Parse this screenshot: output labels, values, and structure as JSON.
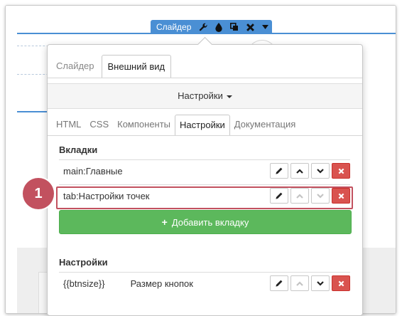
{
  "toolbar": {
    "label": "Слайдер",
    "icons": [
      "wrench-icon",
      "drop-icon",
      "copy-icon",
      "close-icon",
      "caret-down-icon"
    ]
  },
  "tabs_top": [
    {
      "label": "Слайдер",
      "active": false
    },
    {
      "label": "Внешний вид",
      "active": true
    }
  ],
  "settings_dropdown": {
    "label": "Настройки"
  },
  "tabs_inner": [
    {
      "label": "HTML",
      "active": false
    },
    {
      "label": "CSS",
      "active": false
    },
    {
      "label": "Компоненты",
      "active": false
    },
    {
      "label": "Настройки",
      "active": true
    },
    {
      "label": "Документация",
      "active": false
    }
  ],
  "tabs_section": {
    "title": "Вкладки",
    "rows": [
      {
        "name": "main:Главные"
      },
      {
        "name": "tab:Настройки точек"
      }
    ],
    "add_button": "Добавить вкладку"
  },
  "marker": {
    "number": "1"
  },
  "settings_section": {
    "title": "Настройки",
    "rows": [
      {
        "key": "{{btnsize}}",
        "label": "Размер кнопок"
      }
    ]
  },
  "colors": {
    "accent": "#4a8fd4",
    "success": "#5cb85c",
    "danger": "#d9534f",
    "marker": "#c2515f"
  }
}
